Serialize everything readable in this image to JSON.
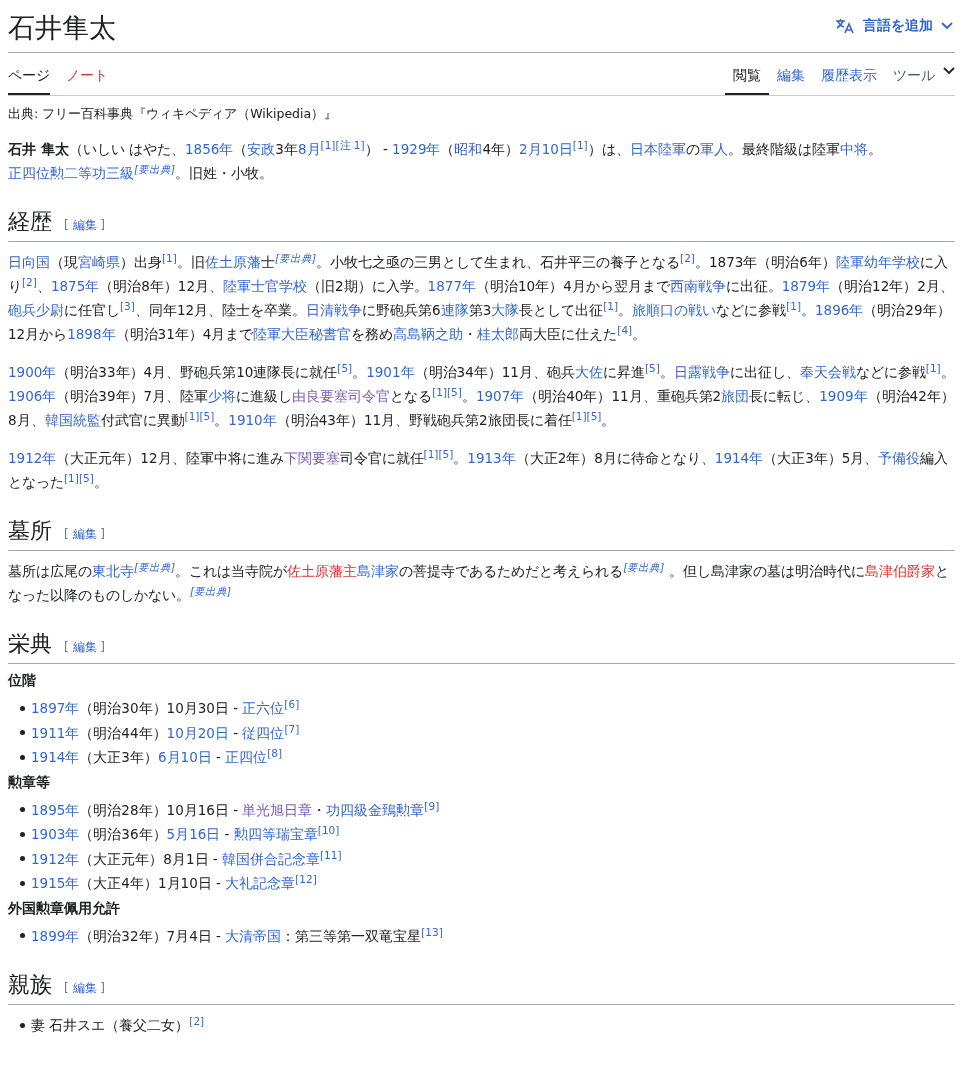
{
  "page_title": "石井隼太",
  "language_button": {
    "label": "言語を追加"
  },
  "namespace_tabs": [
    {
      "label": "ページ",
      "selected": true,
      "missing": false
    },
    {
      "label": "ノート",
      "selected": false,
      "missing": true
    }
  ],
  "view_tabs": [
    {
      "label": "閲覧",
      "selected": true
    },
    {
      "label": "編集",
      "selected": false
    },
    {
      "label": "履歴表示",
      "selected": false
    }
  ],
  "tools_menu": {
    "label": "ツール"
  },
  "tagline": "出典: フリー百科事典『ウィキペディア（Wikipedia）』",
  "lead": [
    {
      "kind": "bold",
      "text": "石井 隼太"
    },
    "（いしい はやた、",
    {
      "kind": "link",
      "text": "1856年"
    },
    "（",
    {
      "kind": "link",
      "text": "安政"
    },
    "3年",
    {
      "kind": "link",
      "text": "8月"
    },
    {
      "kind": "ref",
      "text": "[1]"
    },
    {
      "kind": "ref",
      "text": "[注 1]"
    },
    "） - ",
    {
      "kind": "link",
      "text": "1929年"
    },
    "（",
    {
      "kind": "link",
      "text": "昭和"
    },
    "4年）",
    {
      "kind": "link",
      "text": "2月10日"
    },
    {
      "kind": "ref",
      "text": "[1]"
    },
    "）は、",
    {
      "kind": "link",
      "text": "日本陸軍"
    },
    "の",
    {
      "kind": "link",
      "text": "軍人"
    },
    "。最終階級は陸軍",
    {
      "kind": "link",
      "text": "中将"
    },
    "。",
    {
      "kind": "link",
      "text": "正四位勲二等功三級"
    },
    {
      "kind": "cn",
      "text": "[要出典]"
    },
    "。旧姓・小牧。"
  ],
  "sections": [
    {
      "heading": "経歴",
      "edit": {
        "open": "[",
        "label": "編集",
        "close": "]"
      },
      "blocks": [
        {
          "kind": "p",
          "segments": [
            {
              "kind": "link",
              "text": "日向国"
            },
            "（現",
            {
              "kind": "link",
              "text": "宮崎県"
            },
            "）出身",
            {
              "kind": "ref",
              "text": "[1]"
            },
            "。旧",
            {
              "kind": "link",
              "text": "佐土原藩"
            },
            "士",
            {
              "kind": "cn",
              "text": "[要出典]"
            },
            "。小牧七之亟の三男として生まれ、石井平三の養子となる",
            {
              "kind": "ref",
              "text": "[2]"
            },
            "。1873年（明治6年）",
            {
              "kind": "link",
              "text": "陸軍幼年学校"
            },
            "に入り",
            {
              "kind": "ref",
              "text": "[2]"
            },
            "、",
            {
              "kind": "link",
              "text": "1875年"
            },
            "（明治8年）12月、",
            {
              "kind": "link",
              "text": "陸軍士官学校"
            },
            "（旧2期）に入学。",
            {
              "kind": "link",
              "text": "1877年"
            },
            "（明治10年）4月から翌月まで",
            {
              "kind": "link",
              "text": "西南戦争"
            },
            "に出征。",
            {
              "kind": "link",
              "text": "1879年"
            },
            "（明治12年）2月、",
            {
              "kind": "link",
              "text": "砲兵少尉"
            },
            "に任官し",
            {
              "kind": "ref",
              "text": "[3]"
            },
            "、同年12月、陸士を卒業。",
            {
              "kind": "link",
              "text": "日清戦争"
            },
            "に野砲兵第6",
            {
              "kind": "link",
              "text": "連隊"
            },
            "第3",
            {
              "kind": "link",
              "text": "大隊"
            },
            "長として出征",
            {
              "kind": "ref",
              "text": "[1]"
            },
            "。",
            {
              "kind": "link",
              "text": "旅順口の戦い"
            },
            "などに参戦",
            {
              "kind": "ref",
              "text": "[1]"
            },
            "。",
            {
              "kind": "link",
              "text": "1896年"
            },
            "（明治29年）12月から",
            {
              "kind": "link",
              "text": "1898年"
            },
            "（明治31年）4月まで",
            {
              "kind": "link",
              "text": "陸軍大臣秘書官"
            },
            "を務め",
            {
              "kind": "link",
              "text": "高島鞆之助"
            },
            "・",
            {
              "kind": "link",
              "text": "桂太郎"
            },
            "両大臣に仕えた",
            {
              "kind": "ref",
              "text": "[4]"
            },
            "。"
          ]
        },
        {
          "kind": "p",
          "segments": [
            {
              "kind": "link",
              "text": "1900年"
            },
            "（明治33年）4月、野砲兵第10連隊長に就任",
            {
              "kind": "ref",
              "text": "[5]"
            },
            "。",
            {
              "kind": "link",
              "text": "1901年"
            },
            "（明治34年）11月、砲兵",
            {
              "kind": "link",
              "text": "大佐"
            },
            "に昇進",
            {
              "kind": "ref",
              "text": "[5]"
            },
            "。",
            {
              "kind": "link",
              "text": "日露戦争"
            },
            "に出征し、",
            {
              "kind": "link",
              "text": "奉天会戦"
            },
            "などに参戦",
            {
              "kind": "ref",
              "text": "[1]"
            },
            "。",
            {
              "kind": "link",
              "text": "1906年"
            },
            "（明治39年）7月、陸軍",
            {
              "kind": "link",
              "text": "少将"
            },
            "に進級し",
            {
              "kind": "visited",
              "text": "由良要塞司令官"
            },
            "となる",
            {
              "kind": "ref",
              "text": "[1]"
            },
            {
              "kind": "ref",
              "text": "[5]"
            },
            "。",
            {
              "kind": "link",
              "text": "1907年"
            },
            "（明治40年）11月、重砲兵第2",
            {
              "kind": "link",
              "text": "旅団"
            },
            "長に転じ、",
            {
              "kind": "link",
              "text": "1909年"
            },
            "（明治42年）8月、",
            {
              "kind": "link",
              "text": "韓国統監"
            },
            "付武官に異動",
            {
              "kind": "ref",
              "text": "[1]"
            },
            {
              "kind": "ref",
              "text": "[5]"
            },
            "。",
            {
              "kind": "link",
              "text": "1910年"
            },
            "（明治43年）11月、野戦砲兵第2旅団長に着任",
            {
              "kind": "ref",
              "text": "[1]"
            },
            {
              "kind": "ref",
              "text": "[5]"
            },
            "。"
          ]
        },
        {
          "kind": "p",
          "segments": [
            {
              "kind": "link",
              "text": "1912年"
            },
            "（大正元年）12月、陸軍中将に進み",
            {
              "kind": "visited",
              "text": "下関要塞"
            },
            "司令官に就任",
            {
              "kind": "ref",
              "text": "[1]"
            },
            {
              "kind": "ref",
              "text": "[5]"
            },
            "。",
            {
              "kind": "link",
              "text": "1913年"
            },
            "（大正2年）8月に待命となり、",
            {
              "kind": "link",
              "text": "1914年"
            },
            "（大正3年）5月、",
            {
              "kind": "link",
              "text": "予備役"
            },
            "編入となった",
            {
              "kind": "ref",
              "text": "[1]"
            },
            {
              "kind": "ref",
              "text": "[5]"
            },
            "。"
          ]
        }
      ]
    },
    {
      "heading": "墓所",
      "edit": {
        "open": "[",
        "label": "編集",
        "close": "]"
      },
      "blocks": [
        {
          "kind": "p",
          "segments": [
            "墓所は広尾の",
            {
              "kind": "link",
              "text": "東北寺"
            },
            {
              "kind": "cn",
              "text": "[要出典]"
            },
            "。これは当寺院が",
            {
              "kind": "new",
              "text": "佐土原藩主"
            },
            {
              "kind": "link",
              "text": "島津家"
            },
            "の菩提寺であるためだと考えられる",
            {
              "kind": "cn",
              "text": "[要出典]"
            },
            " 。但し島津家の墓は明治時代に",
            {
              "kind": "new",
              "text": "島津伯爵家"
            },
            "となった以降のものしかない。",
            {
              "kind": "cn",
              "text": "[要出典]"
            }
          ]
        }
      ]
    },
    {
      "heading": "栄典",
      "edit": {
        "open": "[",
        "label": "編集",
        "close": "]"
      },
      "blocks": [
        {
          "kind": "h3",
          "text": "位階"
        },
        {
          "kind": "ul",
          "items": [
            [
              {
                "kind": "link",
                "text": "1897年"
              },
              "（明治30年）10月30日 - ",
              {
                "kind": "link",
                "text": "正六位"
              },
              {
                "kind": "ref",
                "text": "[6]"
              }
            ],
            [
              {
                "kind": "link",
                "text": "1911年"
              },
              "（明治44年）",
              {
                "kind": "link",
                "text": "10月20日"
              },
              " - ",
              {
                "kind": "link",
                "text": "従四位"
              },
              {
                "kind": "ref",
                "text": "[7]"
              }
            ],
            [
              {
                "kind": "link",
                "text": "1914年"
              },
              "（大正3年）",
              {
                "kind": "link",
                "text": "6月10日"
              },
              " - ",
              {
                "kind": "link",
                "text": "正四位"
              },
              {
                "kind": "ref",
                "text": "[8]"
              }
            ]
          ]
        },
        {
          "kind": "h3",
          "text": "勲章等"
        },
        {
          "kind": "ul",
          "items": [
            [
              {
                "kind": "link",
                "text": "1895年"
              },
              "（明治28年）10月16日 - ",
              {
                "kind": "visited",
                "text": "単光旭日章"
              },
              "・",
              {
                "kind": "link",
                "text": "功四級金鵄勲章"
              },
              {
                "kind": "ref",
                "text": "[9]"
              }
            ],
            [
              {
                "kind": "link",
                "text": "1903年"
              },
              "（明治36年）",
              {
                "kind": "link",
                "text": "5月16日"
              },
              " - ",
              {
                "kind": "link",
                "text": "勲四等瑞宝章"
              },
              {
                "kind": "ref",
                "text": "[10]"
              }
            ],
            [
              {
                "kind": "link",
                "text": "1912年"
              },
              "（大正元年）8月1日 - ",
              {
                "kind": "link",
                "text": "韓国併合記念章"
              },
              {
                "kind": "ref",
                "text": "[11]"
              }
            ],
            [
              {
                "kind": "link",
                "text": "1915年"
              },
              "（大正4年）1月10日 - ",
              {
                "kind": "link",
                "text": "大礼記念章"
              },
              {
                "kind": "ref",
                "text": "[12]"
              }
            ]
          ]
        },
        {
          "kind": "h3",
          "text": "外国勲章佩用允許"
        },
        {
          "kind": "ul",
          "items": [
            [
              {
                "kind": "link",
                "text": "1899年"
              },
              "（明治32年）7月4日 - ",
              {
                "kind": "link",
                "text": "大清帝国"
              },
              "：第三等第一双竜宝星",
              {
                "kind": "ref",
                "text": "[13]"
              }
            ]
          ]
        }
      ]
    },
    {
      "heading": "親族",
      "edit": {
        "open": "[",
        "label": "編集",
        "close": "]"
      },
      "blocks": [
        {
          "kind": "ul",
          "items": [
            [
              "妻 石井スエ（養父二女）",
              {
                "kind": "ref",
                "text": "[2]"
              }
            ]
          ]
        }
      ]
    }
  ]
}
